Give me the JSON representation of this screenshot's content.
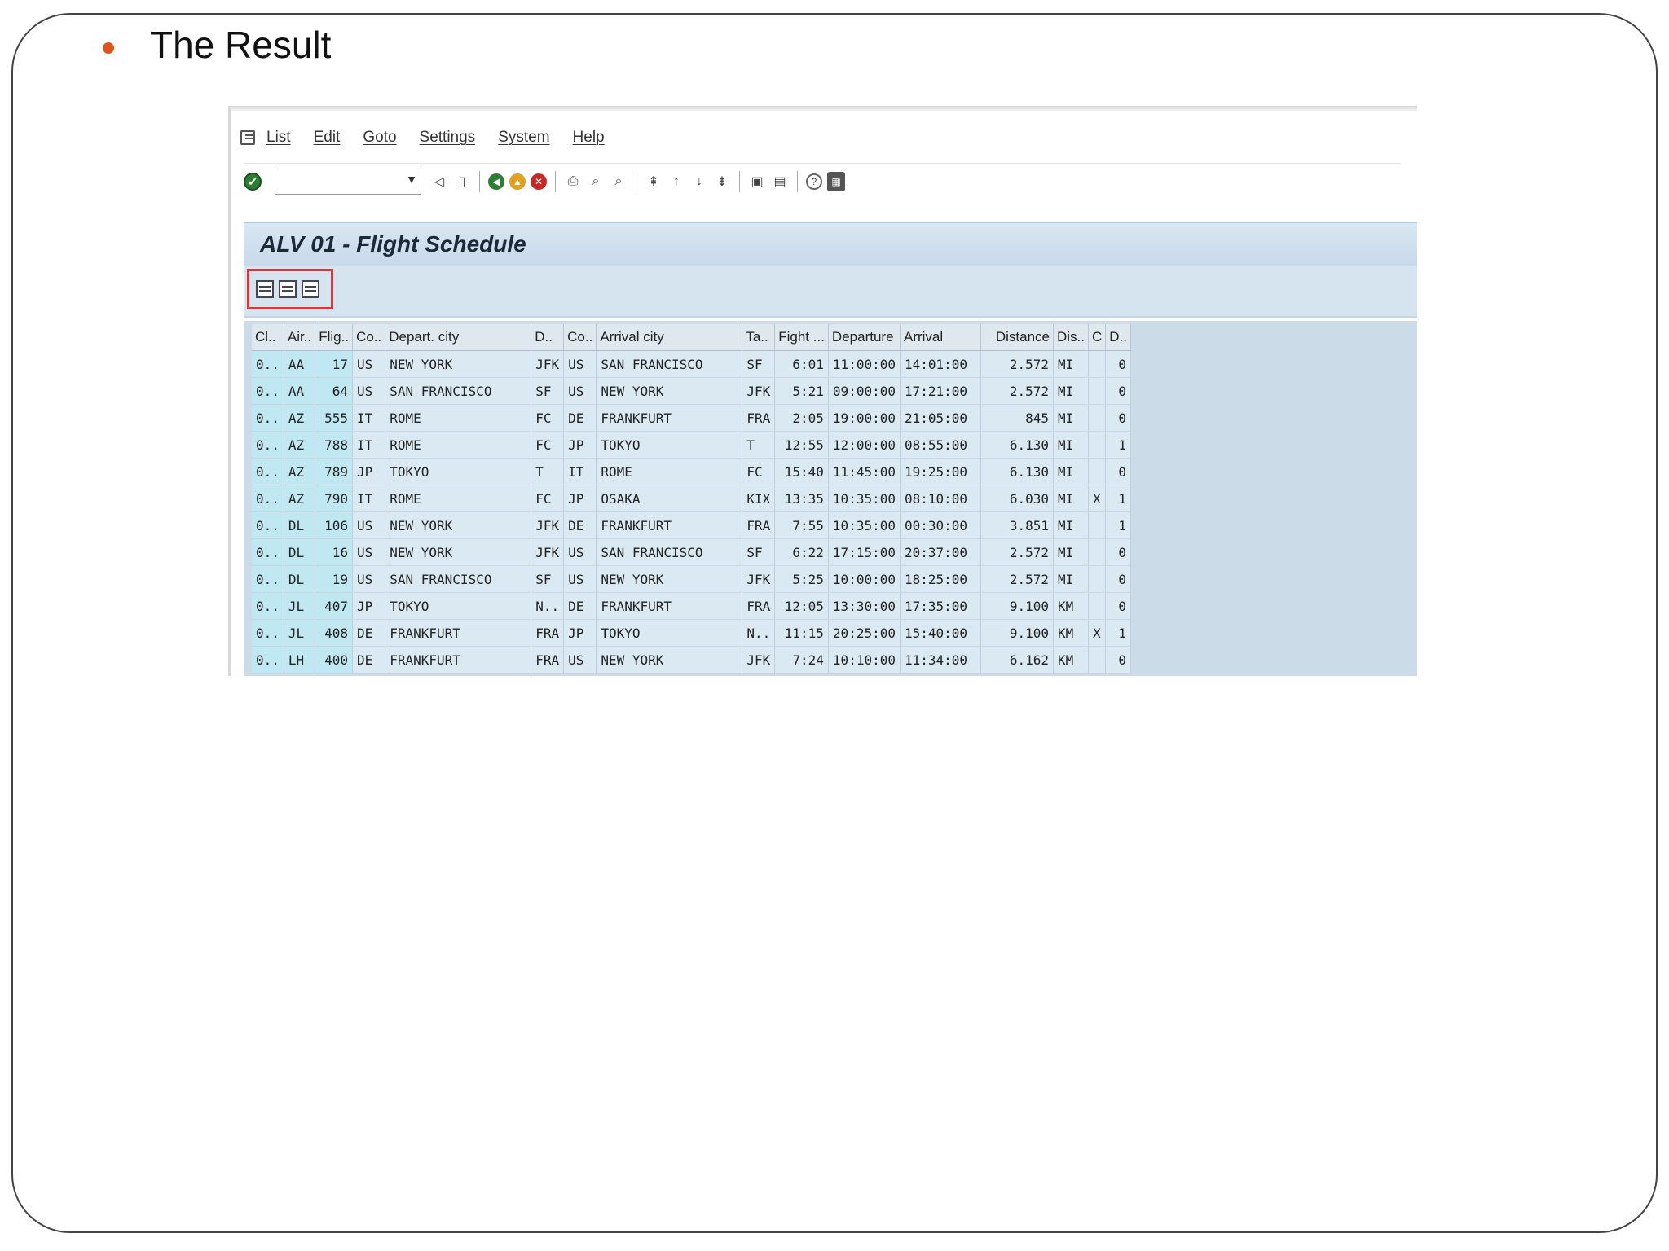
{
  "slide": {
    "title": "The Result"
  },
  "colors": {
    "bullet": "#e0531f",
    "highlight_box": "#d9373a",
    "key_column_bg": "#bfe8f2",
    "grid_bg": "#dbe9f3"
  },
  "sap": {
    "menu": [
      "List",
      "Edit",
      "Goto",
      "Settings",
      "System",
      "Help"
    ],
    "command_field": {
      "value": "",
      "placeholder": ""
    },
    "toolbar_icons": [
      "enter-icon",
      "back-icon",
      "save-icon",
      "back-nav-icon",
      "exit-icon",
      "cancel-icon",
      "print-icon",
      "find-icon",
      "find-next-icon",
      "first-page-icon",
      "previous-page-icon",
      "next-page-icon",
      "last-page-icon",
      "create-session-icon",
      "shortcut-icon",
      "help-icon",
      "customize-layout-icon"
    ],
    "app_title": "ALV 01 - Flight Schedule",
    "app_toolbar_icons": [
      "layout-icon",
      "columns-icon",
      "export-icon"
    ],
    "table": {
      "headers": [
        "Cl..",
        "Air..",
        "Flig..",
        "Co..",
        "Depart. city",
        "D..",
        "Co..",
        "Arrival city",
        "Ta..",
        "Fight ...",
        "Departure",
        "Arrival",
        "Distance",
        "Dis..",
        "C",
        "D.."
      ],
      "rows": [
        [
          "0..",
          "AA",
          "17",
          "US",
          "NEW YORK",
          "JFK",
          "US",
          "SAN FRANCISCO",
          "SF",
          "6:01",
          "11:00:00",
          "14:01:00",
          "2.572",
          "MI",
          "",
          "0"
        ],
        [
          "0..",
          "AA",
          "64",
          "US",
          "SAN FRANCISCO",
          "SF",
          "US",
          "NEW YORK",
          "JFK",
          "5:21",
          "09:00:00",
          "17:21:00",
          "2.572",
          "MI",
          "",
          "0"
        ],
        [
          "0..",
          "AZ",
          "555",
          "IT",
          "ROME",
          "FC",
          "DE",
          "FRANKFURT",
          "FRA",
          "2:05",
          "19:00:00",
          "21:05:00",
          "845",
          "MI",
          "",
          "0"
        ],
        [
          "0..",
          "AZ",
          "788",
          "IT",
          "ROME",
          "FC",
          "JP",
          "TOKYO",
          "T",
          "12:55",
          "12:00:00",
          "08:55:00",
          "6.130",
          "MI",
          "",
          "1"
        ],
        [
          "0..",
          "AZ",
          "789",
          "JP",
          "TOKYO",
          "T",
          "IT",
          "ROME",
          "FC",
          "15:40",
          "11:45:00",
          "19:25:00",
          "6.130",
          "MI",
          "",
          "0"
        ],
        [
          "0..",
          "AZ",
          "790",
          "IT",
          "ROME",
          "FC",
          "JP",
          "OSAKA",
          "KIX",
          "13:35",
          "10:35:00",
          "08:10:00",
          "6.030",
          "MI",
          "X",
          "1"
        ],
        [
          "0..",
          "DL",
          "106",
          "US",
          "NEW YORK",
          "JFK",
          "DE",
          "FRANKFURT",
          "FRA",
          "7:55",
          "10:35:00",
          "00:30:00",
          "3.851",
          "MI",
          "",
          "1"
        ],
        [
          "0..",
          "DL",
          "16",
          "US",
          "NEW YORK",
          "JFK",
          "US",
          "SAN FRANCISCO",
          "SF",
          "6:22",
          "17:15:00",
          "20:37:00",
          "2.572",
          "MI",
          "",
          "0"
        ],
        [
          "0..",
          "DL",
          "19",
          "US",
          "SAN FRANCISCO",
          "SF",
          "US",
          "NEW YORK",
          "JFK",
          "5:25",
          "10:00:00",
          "18:25:00",
          "2.572",
          "MI",
          "",
          "0"
        ],
        [
          "0..",
          "JL",
          "407",
          "JP",
          "TOKYO",
          "N..",
          "DE",
          "FRANKFURT",
          "FRA",
          "12:05",
          "13:30:00",
          "17:35:00",
          "9.100",
          "KM",
          "",
          "0"
        ],
        [
          "0..",
          "JL",
          "408",
          "DE",
          "FRANKFURT",
          "FRA",
          "JP",
          "TOKYO",
          "N..",
          "11:15",
          "20:25:00",
          "15:40:00",
          "9.100",
          "KM",
          "X",
          "1"
        ],
        [
          "0..",
          "LH",
          "400",
          "DE",
          "FRANKFURT",
          "FRA",
          "US",
          "NEW YORK",
          "JFK",
          "7:24",
          "10:10:00",
          "11:34:00",
          "6.162",
          "KM",
          "",
          "0"
        ]
      ]
    }
  }
}
